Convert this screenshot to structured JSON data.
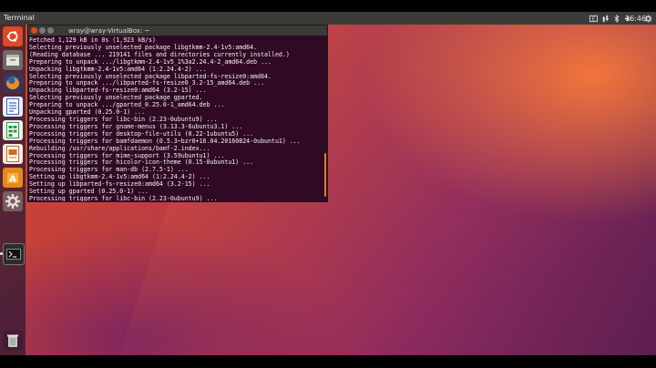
{
  "topbar": {
    "app_title": "Terminal",
    "clock": "16:46",
    "icons": [
      "keyboard-icon",
      "network-icon",
      "bluetooth-icon",
      "volume-icon",
      "settings-gear-icon"
    ]
  },
  "launcher": {
    "items": [
      "ubuntu-logo-icon",
      "files-icon",
      "firefox-icon",
      "writer-icon",
      "calc-icon",
      "impress-icon",
      "software-center-icon",
      "system-settings-icon",
      "terminal-icon",
      "trash-icon"
    ]
  },
  "terminal": {
    "title": "wray@wray-VirtualBox: ~",
    "lines": [
      "Fetched 1,129 kB in 0s (1,923 kB/s)",
      "Selecting previously unselected package libgtkmm-2.4-1v5:amd64.",
      "(Reading database ... 219141 files and directories currently installed.)",
      "Preparing to unpack .../libgtkmm-2.4-1v5_1%3a2.24.4-2_amd64.deb ...",
      "Unpacking libgtkmm-2.4-1v5:amd64 (1:2.24.4-2) ...",
      "Selecting previously unselected package libparted-fs-resize0:amd64.",
      "Preparing to unpack .../libparted-fs-resize0_3.2-15_amd64.deb ...",
      "Unpacking libparted-fs-resize0:amd64 (3.2-15) ...",
      "Selecting previously unselected package gparted.",
      "Preparing to unpack .../gparted_0.25.0-1_amd64.deb ...",
      "Unpacking gparted (0.25.0-1) ...",
      "Processing triggers for libc-bin (2.23-0ubuntu9) ...",
      "Processing triggers for gnome-menus (3.13.3-6ubuntu3.1) ...",
      "Processing triggers for desktop-file-utils (0.22-1ubuntu5) ...",
      "Processing triggers for bamfdaemon (0.5.3~bzr0+16.04.20160824-0ubuntu1) ...",
      "Rebuilding /usr/share/applications/bamf-2.index...",
      "Processing triggers for mime-support (3.59ubuntu1) ...",
      "Processing triggers for hicolor-icon-theme (0.15-0ubuntu1) ...",
      "Processing triggers for man-db (2.7.5-1) ...",
      "Setting up libgtkmm-2.4-1v5:amd64 (1:2.24.4-2) ...",
      "Setting up libparted-fs-resize0:amd64 (3.2-15) ...",
      "Setting up gparted (0.25.0-1) ...",
      "Processing triggers for libc-bin (2.23-0ubuntu9) ..."
    ]
  }
}
